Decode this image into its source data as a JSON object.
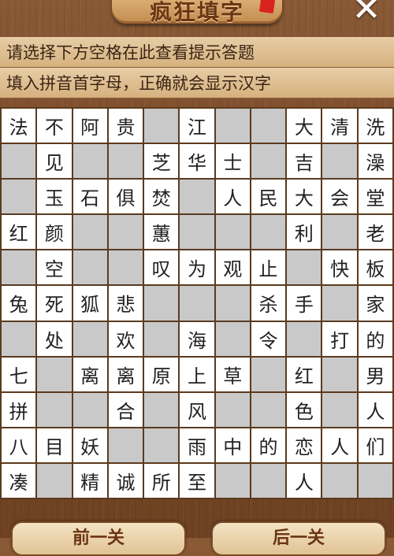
{
  "header": {
    "title": "疯狂填字",
    "close_symbol": "✕"
  },
  "hints": {
    "line1": "请选择下方空格在此查看提示答题",
    "line2": "填入拼音首字母，正确就会显示汉字"
  },
  "grid": [
    [
      "法",
      "不",
      "阿",
      "贵",
      "",
      "江",
      "",
      "",
      "大",
      "清",
      "洗"
    ],
    [
      "",
      "见",
      "",
      "",
      "芝",
      "华",
      "士",
      "",
      "吉",
      "",
      "澡"
    ],
    [
      "",
      "玉",
      "石",
      "俱",
      "焚",
      "",
      "人",
      "民",
      "大",
      "会",
      "堂"
    ],
    [
      "红",
      "颜",
      "",
      "",
      "蕙",
      "",
      "",
      "",
      "利",
      "",
      "老"
    ],
    [
      "",
      "空",
      "",
      "",
      "叹",
      "为",
      "观",
      "止",
      "",
      "快",
      "板"
    ],
    [
      "兔",
      "死",
      "狐",
      "悲",
      "",
      "",
      "",
      "杀",
      "手",
      "",
      "家"
    ],
    [
      "",
      "处",
      "",
      "欢",
      "",
      "海",
      "",
      "令",
      "",
      "打",
      "的"
    ],
    [
      "七",
      "",
      "离",
      "离",
      "原",
      "上",
      "草",
      "",
      "红",
      "",
      "男"
    ],
    [
      "拼",
      "",
      "",
      "合",
      "",
      "风",
      "",
      "",
      "色",
      "",
      "人"
    ],
    [
      "八",
      "目",
      "妖",
      "",
      "",
      "雨",
      "中",
      "的",
      "恋",
      "人",
      "们"
    ],
    [
      "凑",
      "",
      "精",
      "诚",
      "所",
      "至",
      "",
      "",
      "人",
      "",
      ""
    ]
  ],
  "footer": {
    "prev_label": "前一关",
    "next_label": "后一关"
  },
  "colors": {
    "accent_red": "#d8231f",
    "empty_cell": "#c9c9c9",
    "wood": "#7a4a28"
  }
}
